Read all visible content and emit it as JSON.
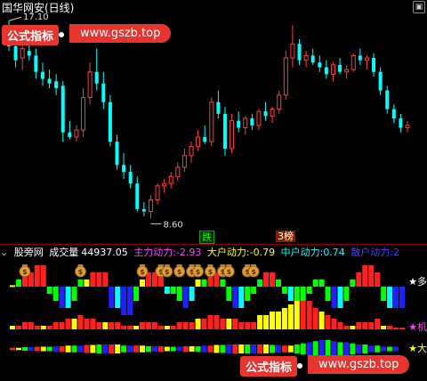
{
  "header": {
    "title": "国华网安(日线)",
    "menu_icon": "square-icon"
  },
  "watermark": {
    "left_text": "公式指标",
    "right_text": "www.gszb.top"
  },
  "price_chart": {
    "high_label": "17.10",
    "low_label": "8.60",
    "tag_down": "跌",
    "tag_top": "3榜",
    "up_color": "#ff3c3c",
    "down_color": "#00ffff"
  },
  "indicator_bar": {
    "icon": "chevron-down-icon",
    "name": "股旁网",
    "volume_label": "成交量",
    "volume_value": "44937.05",
    "main_label": "主力动力:",
    "main_value": "-2.93",
    "big_label": "大户动力:",
    "big_value": "-0.79",
    "mid_label": "中户动力:",
    "mid_value": "0.74",
    "retail_label": "散户动力:",
    "retail_value": "2"
  },
  "indicator_panel": {
    "labels": [
      "★多",
      "★机",
      "★大"
    ],
    "money_bag_glyph": "$"
  },
  "chart_data": [
    {
      "type": "candlestick",
      "title": "国华网安(日线)",
      "annotations": [
        "17.10",
        "8.60"
      ],
      "candles": [
        {
          "o": 16.4,
          "h": 17.1,
          "l": 15.8,
          "c": 16.0
        },
        {
          "o": 16.0,
          "h": 16.3,
          "l": 15.1,
          "c": 15.4
        },
        {
          "o": 15.5,
          "h": 16.1,
          "l": 15.0,
          "c": 15.9
        },
        {
          "o": 15.8,
          "h": 16.2,
          "l": 15.4,
          "c": 15.6
        },
        {
          "o": 15.6,
          "h": 15.9,
          "l": 14.6,
          "c": 14.9
        },
        {
          "o": 14.9,
          "h": 15.3,
          "l": 14.3,
          "c": 14.6
        },
        {
          "o": 14.6,
          "h": 15.0,
          "l": 14.2,
          "c": 14.4
        },
        {
          "o": 14.5,
          "h": 14.8,
          "l": 13.9,
          "c": 14.2
        },
        {
          "o": 14.3,
          "h": 14.5,
          "l": 11.9,
          "c": 12.3
        },
        {
          "o": 12.3,
          "h": 12.8,
          "l": 12.0,
          "c": 12.1
        },
        {
          "o": 12.1,
          "h": 12.6,
          "l": 11.9,
          "c": 12.4
        },
        {
          "o": 12.4,
          "h": 14.2,
          "l": 12.1,
          "c": 13.8
        },
        {
          "o": 13.8,
          "h": 15.3,
          "l": 13.5,
          "c": 14.9
        },
        {
          "o": 14.9,
          "h": 15.9,
          "l": 14.1,
          "c": 14.4
        },
        {
          "o": 14.4,
          "h": 14.9,
          "l": 13.3,
          "c": 13.6
        },
        {
          "o": 13.6,
          "h": 13.9,
          "l": 11.7,
          "c": 11.9
        },
        {
          "o": 11.9,
          "h": 12.2,
          "l": 10.7,
          "c": 10.9
        },
        {
          "o": 10.9,
          "h": 11.4,
          "l": 10.3,
          "c": 10.6
        },
        {
          "o": 10.6,
          "h": 10.9,
          "l": 9.9,
          "c": 10.1
        },
        {
          "o": 10.1,
          "h": 10.4,
          "l": 8.9,
          "c": 9.0
        },
        {
          "o": 9.0,
          "h": 9.3,
          "l": 8.7,
          "c": 8.9
        },
        {
          "o": 8.9,
          "h": 9.6,
          "l": 8.6,
          "c": 9.4
        },
        {
          "o": 9.4,
          "h": 10.1,
          "l": 9.2,
          "c": 10.0
        },
        {
          "o": 10.0,
          "h": 10.3,
          "l": 9.7,
          "c": 10.1
        },
        {
          "o": 10.1,
          "h": 10.6,
          "l": 9.9,
          "c": 10.4
        },
        {
          "o": 10.4,
          "h": 11.0,
          "l": 10.2,
          "c": 10.8
        },
        {
          "o": 10.8,
          "h": 11.6,
          "l": 10.6,
          "c": 11.3
        },
        {
          "o": 11.3,
          "h": 11.9,
          "l": 11.0,
          "c": 11.7
        },
        {
          "o": 11.7,
          "h": 12.4,
          "l": 11.5,
          "c": 12.1
        },
        {
          "o": 12.1,
          "h": 12.6,
          "l": 11.8,
          "c": 11.9
        },
        {
          "o": 11.9,
          "h": 13.8,
          "l": 11.7,
          "c": 13.6
        },
        {
          "o": 13.6,
          "h": 14.1,
          "l": 12.9,
          "c": 13.1
        },
        {
          "o": 13.1,
          "h": 13.4,
          "l": 11.3,
          "c": 11.6
        },
        {
          "o": 11.6,
          "h": 13.1,
          "l": 11.4,
          "c": 12.8
        },
        {
          "o": 12.8,
          "h": 13.2,
          "l": 12.3,
          "c": 12.5
        },
        {
          "o": 12.5,
          "h": 13.0,
          "l": 12.2,
          "c": 12.9
        },
        {
          "o": 12.9,
          "h": 13.1,
          "l": 12.4,
          "c": 12.6
        },
        {
          "o": 12.6,
          "h": 13.3,
          "l": 12.4,
          "c": 13.2
        },
        {
          "o": 13.2,
          "h": 13.6,
          "l": 12.8,
          "c": 13.0
        },
        {
          "o": 13.0,
          "h": 13.4,
          "l": 12.7,
          "c": 13.3
        },
        {
          "o": 13.3,
          "h": 14.1,
          "l": 13.1,
          "c": 13.9
        },
        {
          "o": 13.9,
          "h": 15.8,
          "l": 13.7,
          "c": 15.5
        },
        {
          "o": 15.5,
          "h": 16.9,
          "l": 15.1,
          "c": 16.1
        },
        {
          "o": 16.1,
          "h": 16.3,
          "l": 15.2,
          "c": 15.4
        },
        {
          "o": 15.4,
          "h": 15.8,
          "l": 15.1,
          "c": 15.6
        },
        {
          "o": 15.6,
          "h": 15.9,
          "l": 15.2,
          "c": 15.3
        },
        {
          "o": 15.3,
          "h": 15.6,
          "l": 14.9,
          "c": 15.1
        },
        {
          "o": 15.1,
          "h": 15.4,
          "l": 14.6,
          "c": 14.8
        },
        {
          "o": 14.8,
          "h": 15.3,
          "l": 14.5,
          "c": 15.2
        },
        {
          "o": 15.2,
          "h": 15.5,
          "l": 14.8,
          "c": 14.9
        },
        {
          "o": 14.9,
          "h": 15.2,
          "l": 14.6,
          "c": 15.0
        },
        {
          "o": 15.0,
          "h": 15.7,
          "l": 14.9,
          "c": 15.6
        },
        {
          "o": 15.6,
          "h": 15.9,
          "l": 15.2,
          "c": 15.4
        },
        {
          "o": 15.4,
          "h": 15.6,
          "l": 15.0,
          "c": 15.5
        },
        {
          "o": 15.5,
          "h": 15.7,
          "l": 14.7,
          "c": 14.9
        },
        {
          "o": 14.9,
          "h": 15.1,
          "l": 13.9,
          "c": 14.1
        },
        {
          "o": 14.1,
          "h": 14.3,
          "l": 13.1,
          "c": 13.3
        },
        {
          "o": 13.3,
          "h": 13.5,
          "l": 12.7,
          "c": 12.9
        },
        {
          "o": 12.9,
          "h": 13.1,
          "l": 12.3,
          "c": 12.5
        },
        {
          "o": 12.5,
          "h": 12.8,
          "l": 12.3,
          "c": 12.6
        }
      ]
    },
    {
      "type": "bar",
      "title": "股旁网",
      "series": [
        {
          "name": "主力动力",
          "values": [
            0.2,
            1,
            2,
            2,
            3,
            3,
            -1,
            -2,
            -3,
            -3,
            -2,
            1,
            1,
            2,
            2,
            2,
            -3,
            -3,
            -4,
            -4,
            -2,
            1,
            2,
            2,
            2,
            -1,
            -1,
            -2,
            -3,
            -2,
            1,
            1,
            2,
            2,
            1,
            -2,
            -3,
            -3,
            -2,
            -1,
            1,
            2,
            2,
            1,
            -1,
            -2,
            -2,
            -2,
            -1,
            1,
            1,
            -2,
            -3,
            -3,
            -2,
            1,
            2,
            3,
            3,
            2,
            -2,
            -3,
            -3,
            -3
          ]
        },
        {
          "name": "大户动力",
          "values": [
            1,
            1,
            2,
            2,
            1,
            1,
            1,
            2,
            2,
            3,
            3,
            4,
            3,
            3,
            2,
            2,
            2,
            2,
            1,
            1,
            1,
            2,
            2,
            2,
            1,
            1,
            1,
            2,
            2,
            2,
            3,
            3,
            4,
            4,
            3,
            3,
            3,
            2,
            2,
            2,
            4,
            4,
            5,
            5,
            6,
            7,
            8,
            8,
            8,
            6,
            5,
            4,
            3,
            2,
            1,
            1,
            2,
            2,
            2,
            3,
            1,
            1,
            0.5,
            0.5
          ]
        },
        {
          "name": "中户动力",
          "values": [
            0.5,
            0.5,
            0.8,
            0.8,
            1,
            1,
            1,
            1.2,
            1.2,
            1.5,
            1.5,
            1.5,
            1.8,
            1.8,
            2,
            2,
            2,
            2,
            1.5,
            1.5,
            1.5,
            1.5,
            1.2,
            1.2,
            1.2,
            1,
            1,
            1,
            1.2,
            1.2,
            1.2,
            1.5,
            1.5,
            1.8,
            1.8,
            2,
            2,
            2,
            2,
            2,
            2,
            2,
            1.8,
            1.8,
            1.5,
            1.5,
            2,
            2.5,
            3,
            3.5,
            4,
            4,
            3.5,
            3,
            3,
            2.5,
            2,
            2,
            1.5,
            1.5,
            1,
            1,
            1
          ]
        }
      ],
      "labels": [
        "★多",
        "★机",
        "★大"
      ]
    }
  ]
}
